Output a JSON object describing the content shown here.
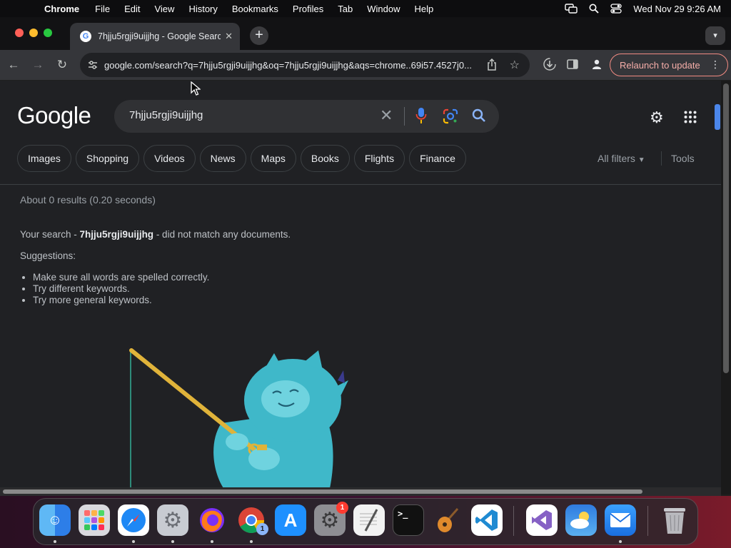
{
  "menubar": {
    "app": "Chrome",
    "items": [
      "File",
      "Edit",
      "View",
      "History",
      "Bookmarks",
      "Profiles",
      "Tab",
      "Window",
      "Help"
    ],
    "clock": "Wed Nov 29  9:26 AM"
  },
  "tab": {
    "title": "7hjju5rgji9uijjhg - Google Search",
    "close": "✕"
  },
  "toolbar": {
    "url": "google.com/search?q=7hjju5rgji9uijjhg&oq=7hjju5rgji9uijjhg&aqs=chrome..69i57.4527j0...",
    "relaunch_label": "Relaunch to update"
  },
  "google": {
    "logo": "Google",
    "query": "7hjju5rgji9uijjhg",
    "chips": [
      "Images",
      "Shopping",
      "Videos",
      "News",
      "Maps",
      "Books",
      "Flights",
      "Finance"
    ],
    "all_filters": "All filters",
    "tools": "Tools",
    "stats": "About 0 results (0.20 seconds)",
    "nomatch_prefix": "Your search - ",
    "nomatch_query": "7hjju5rgji9uijjhg",
    "nomatch_suffix": " - did not match any documents.",
    "suggestions_label": "Suggestions:",
    "tips": [
      "Make sure all words are spelled correctly.",
      "Try different keywords.",
      "Try more general keywords."
    ]
  },
  "dock": {
    "settings_badge": "1",
    "chrome_badge": "1"
  },
  "colors": {
    "accent_blue": "#4285f4",
    "relaunch_border": "#f28b82",
    "page_bg": "#202124"
  }
}
